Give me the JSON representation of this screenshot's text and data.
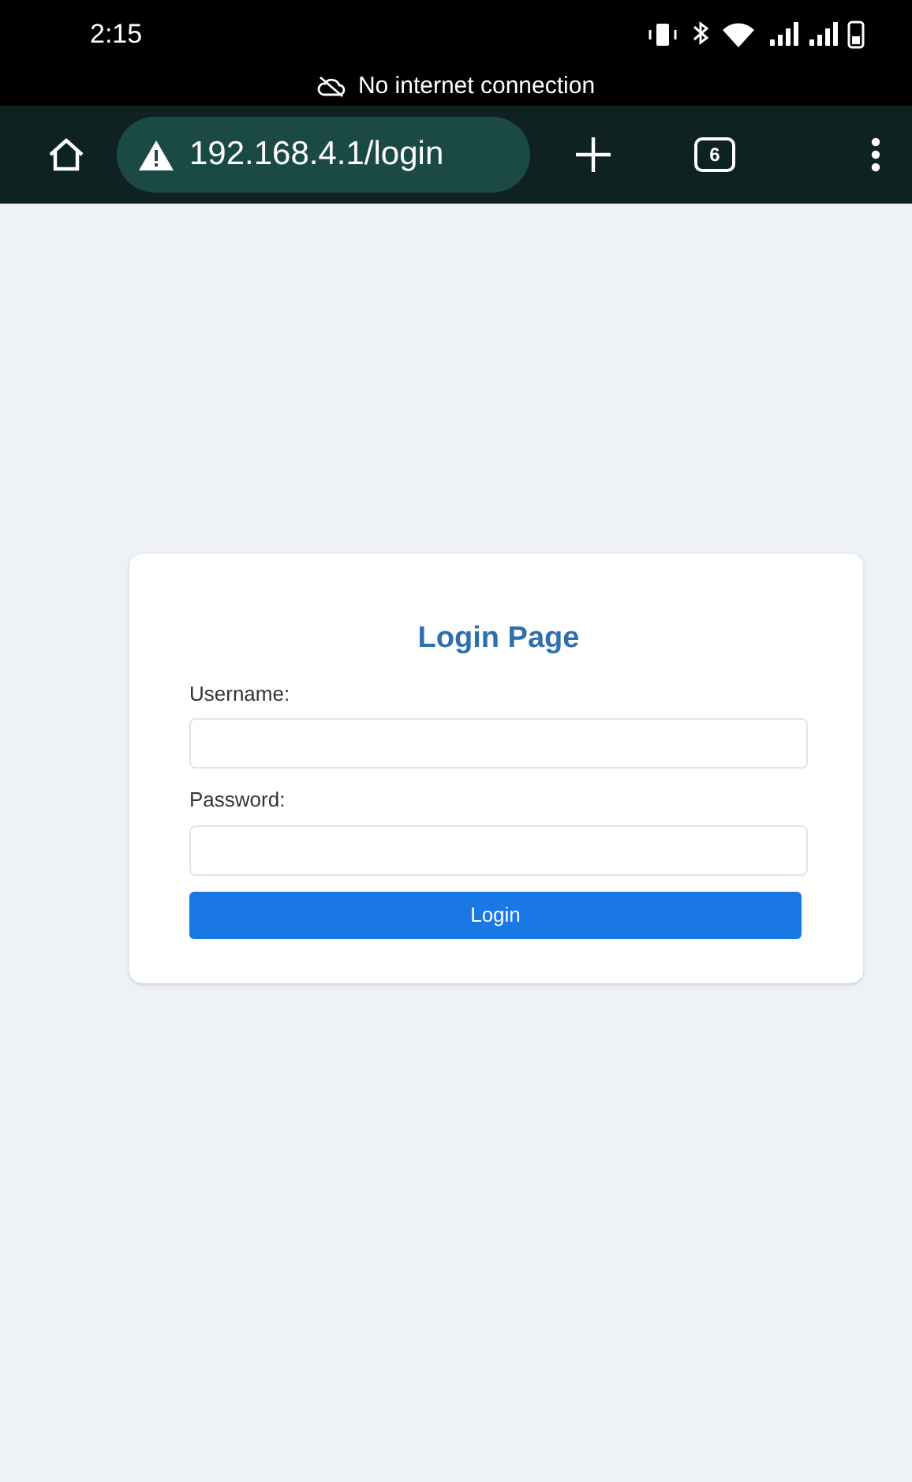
{
  "status_bar": {
    "time": "2:15"
  },
  "notice": {
    "text": "No internet connection"
  },
  "browser": {
    "url": "192.168.4.1/login",
    "tab_count": "6"
  },
  "login": {
    "title": "Login Page",
    "fields": [
      {
        "label": "Username:"
      },
      {
        "label": "Password:"
      }
    ],
    "button": "Login"
  }
}
